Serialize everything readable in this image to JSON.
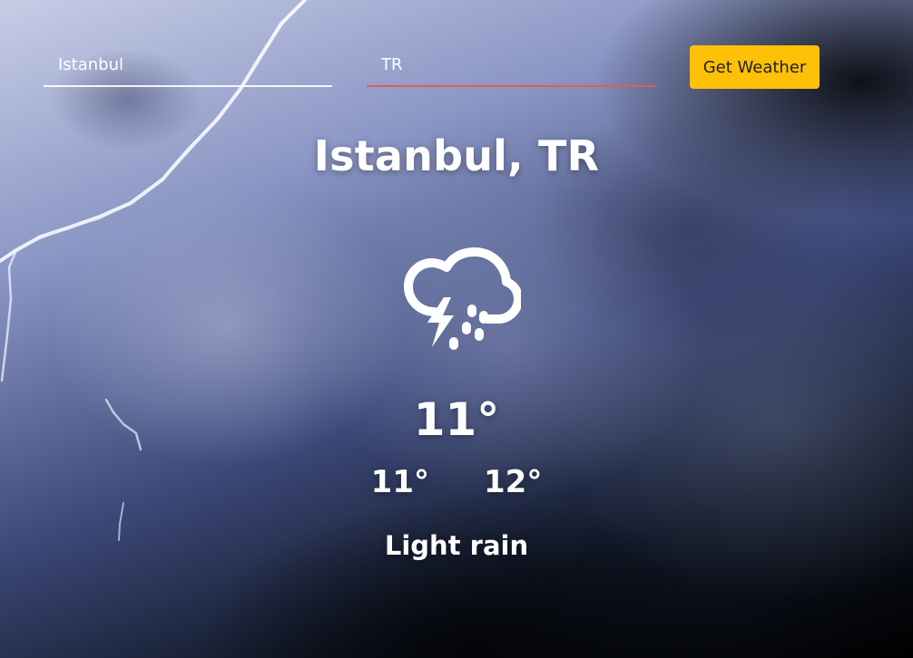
{
  "search": {
    "city_value": "Istanbul",
    "country_value": "TR",
    "button_label": "Get Weather"
  },
  "weather": {
    "location": "Istanbul, TR",
    "icon": "thunderstorm-rain-icon",
    "temperature": "11°",
    "min_temp": "11°",
    "max_temp": "12°",
    "description": "Light rain"
  },
  "colors": {
    "button": "#ffc107",
    "active_underline": "#e35b55",
    "text": "#ffffff"
  }
}
